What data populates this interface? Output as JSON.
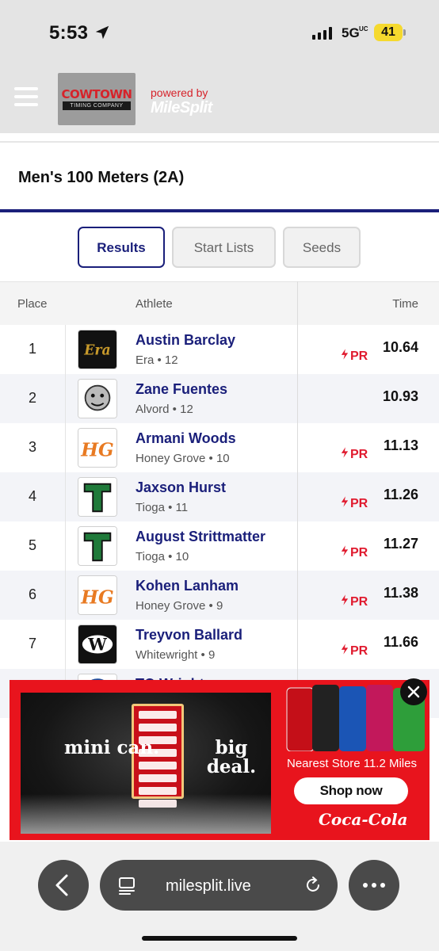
{
  "status_bar": {
    "time": "5:53",
    "network": "5G",
    "network_sub": "UC",
    "battery": "41",
    "colors": {
      "battery": "#f5d92e"
    }
  },
  "header": {
    "logo_title": "COWTOWN",
    "logo_subtitle": "TIMING COMPANY",
    "powered_by": "powered by",
    "brand": "MileSplit",
    "menu_icon": "hamburger-icon"
  },
  "event": {
    "title": "Men's 100 Meters (2A)"
  },
  "tabs": [
    {
      "label": "Results",
      "active": true
    },
    {
      "label": "Start Lists",
      "active": false
    },
    {
      "label": "Seeds",
      "active": false
    }
  ],
  "table": {
    "headers": {
      "place": "Place",
      "athlete": "Athlete",
      "time": "Time"
    },
    "rows": [
      {
        "place": "1",
        "name": "Austin Barclay",
        "team": "Era • 12",
        "pr": "PR",
        "time": "10.64",
        "logo": "Era",
        "logo_color": "#c89a2b",
        "logo_bg": "#111111"
      },
      {
        "place": "2",
        "name": "Zane Fuentes",
        "team": "Alvord • 12",
        "pr": "",
        "time": "10.93",
        "logo": "bulldog",
        "logo_color": "#666666",
        "logo_bg": "#ffffff"
      },
      {
        "place": "3",
        "name": "Armani Woods",
        "team": "Honey Grove • 10",
        "pr": "PR",
        "time": "11.13",
        "logo": "HG",
        "logo_color": "#e87a22",
        "logo_bg": "#ffffff"
      },
      {
        "place": "4",
        "name": "Jaxson Hurst",
        "team": "Tioga • 11",
        "pr": "PR",
        "time": "11.26",
        "logo": "T",
        "logo_color": "#1f7a3a",
        "logo_bg": "#ffffff"
      },
      {
        "place": "5",
        "name": "August Strittmatter",
        "team": "Tioga • 10",
        "pr": "PR",
        "time": "11.27",
        "logo": "T",
        "logo_color": "#1f7a3a",
        "logo_bg": "#ffffff"
      },
      {
        "place": "6",
        "name": "Kohen Lanham",
        "team": "Honey Grove • 9",
        "pr": "PR",
        "time": "11.38",
        "logo": "HG",
        "logo_color": "#e87a22",
        "logo_bg": "#ffffff"
      },
      {
        "place": "7",
        "name": "Treyvon Ballard",
        "team": "Whitewright • 9",
        "pr": "PR",
        "time": "11.66",
        "logo": "W",
        "logo_color": "#c8a24a",
        "logo_bg": "#111111"
      },
      {
        "place": "",
        "name": "TQ Wright",
        "team": "",
        "pr": "",
        "time": "",
        "logo": "",
        "logo_color": "#1a4fa0",
        "logo_bg": "#ffffff"
      }
    ]
  },
  "ad": {
    "left_text": "mini can.",
    "right_text": "big deal.",
    "store": "Nearest Store 11.2 Miles",
    "cta": "Shop now",
    "brand": "Coca-Cola",
    "colors": {
      "background": "#e8141d"
    }
  },
  "browser": {
    "url": "milesplit.live"
  },
  "colors": {
    "navy": "#1a1f7a",
    "pr_red": "#e01b2f"
  }
}
